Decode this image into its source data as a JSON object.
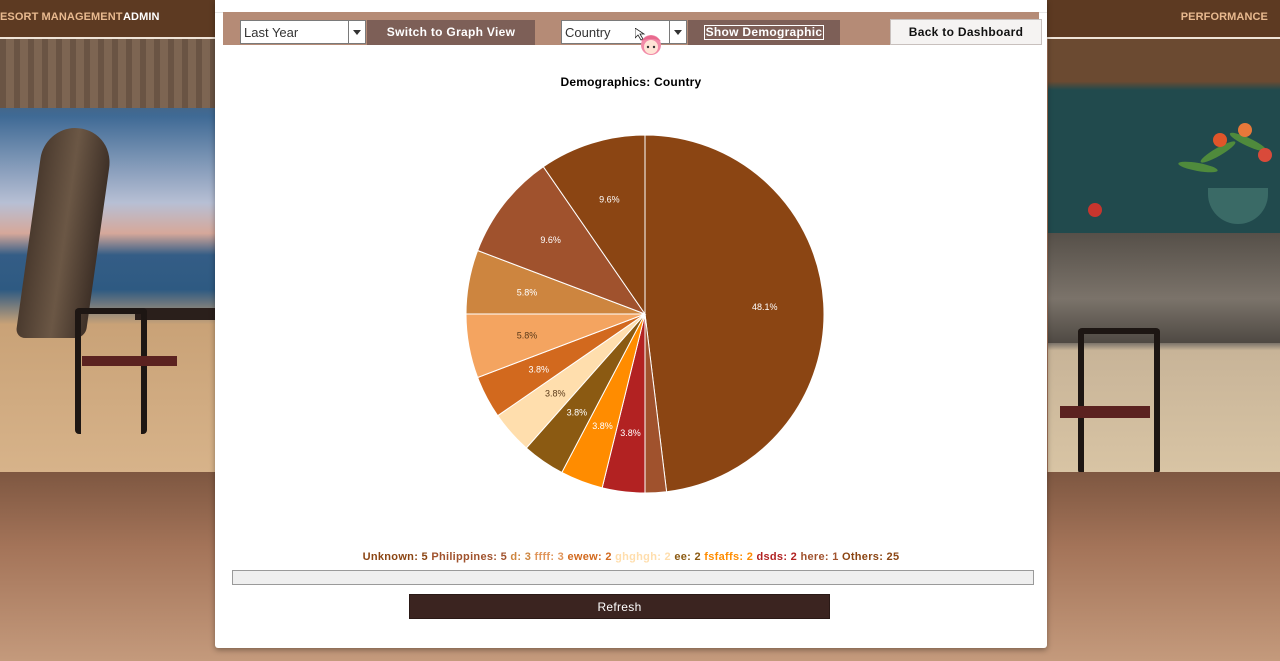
{
  "nav": {
    "brand": "ESORT MANAGEMENT",
    "admin": "ADMIN",
    "performance": "PERFORMANCE"
  },
  "toolbar": {
    "period_select": "Last Year",
    "switch_view_button": "Switch to Graph View",
    "category_select": "Country",
    "show_demographic_button": "Show Demographic",
    "back_button": "Back to Dashboard"
  },
  "chart_data": {
    "type": "pie",
    "title": "Demographics: Country",
    "slices": [
      {
        "label": "Others",
        "value": 25,
        "percent_label": "48.1%",
        "color": "#8b4513"
      },
      {
        "label": "here",
        "value": 1,
        "percent_label": "",
        "color": "#a0522d"
      },
      {
        "label": "dsds",
        "value": 2,
        "percent_label": "3.8%",
        "color": "#b22222"
      },
      {
        "label": "fsfaffs",
        "value": 2,
        "percent_label": "3.8%",
        "color": "#ff8c00"
      },
      {
        "label": "ee",
        "value": 2,
        "percent_label": "3.8%",
        "color": "#8b5a12"
      },
      {
        "label": "ghghgh",
        "value": 2,
        "percent_label": "3.8%",
        "color": "#ffdead"
      },
      {
        "label": "ewew",
        "value": 2,
        "percent_label": "3.8%",
        "color": "#d2691e"
      },
      {
        "label": "ffff",
        "value": 3,
        "percent_label": "5.8%",
        "color": "#f4a460"
      },
      {
        "label": "d",
        "value": 3,
        "percent_label": "5.8%",
        "color": "#cd853f"
      },
      {
        "label": "Philippines",
        "value": 5,
        "percent_label": "9.6%",
        "color": "#a0522d"
      },
      {
        "label": "Unknown",
        "value": 5,
        "percent_label": "9.6%",
        "color": "#8b4513"
      }
    ],
    "legend": [
      {
        "text": "Unknown: 5",
        "color": "#8b4513"
      },
      {
        "text": "Philippines: 5",
        "color": "#a0522d"
      },
      {
        "text": "d: 3",
        "color": "#cd853f"
      },
      {
        "text": "ffff: 3",
        "color": "#e0955a"
      },
      {
        "text": "ewew: 2",
        "color": "#d2691e"
      },
      {
        "text": "ghghgh: 2",
        "color": "#ffdead"
      },
      {
        "text": "ee: 2",
        "color": "#8b5a12"
      },
      {
        "text": "fsfaffs: 2",
        "color": "#ff8c00"
      },
      {
        "text": "dsds: 2",
        "color": "#b22222"
      },
      {
        "text": "here: 1",
        "color": "#a0522d"
      },
      {
        "text": "Others: 25",
        "color": "#8b4513"
      }
    ]
  },
  "actions": {
    "refresh": "Refresh"
  }
}
